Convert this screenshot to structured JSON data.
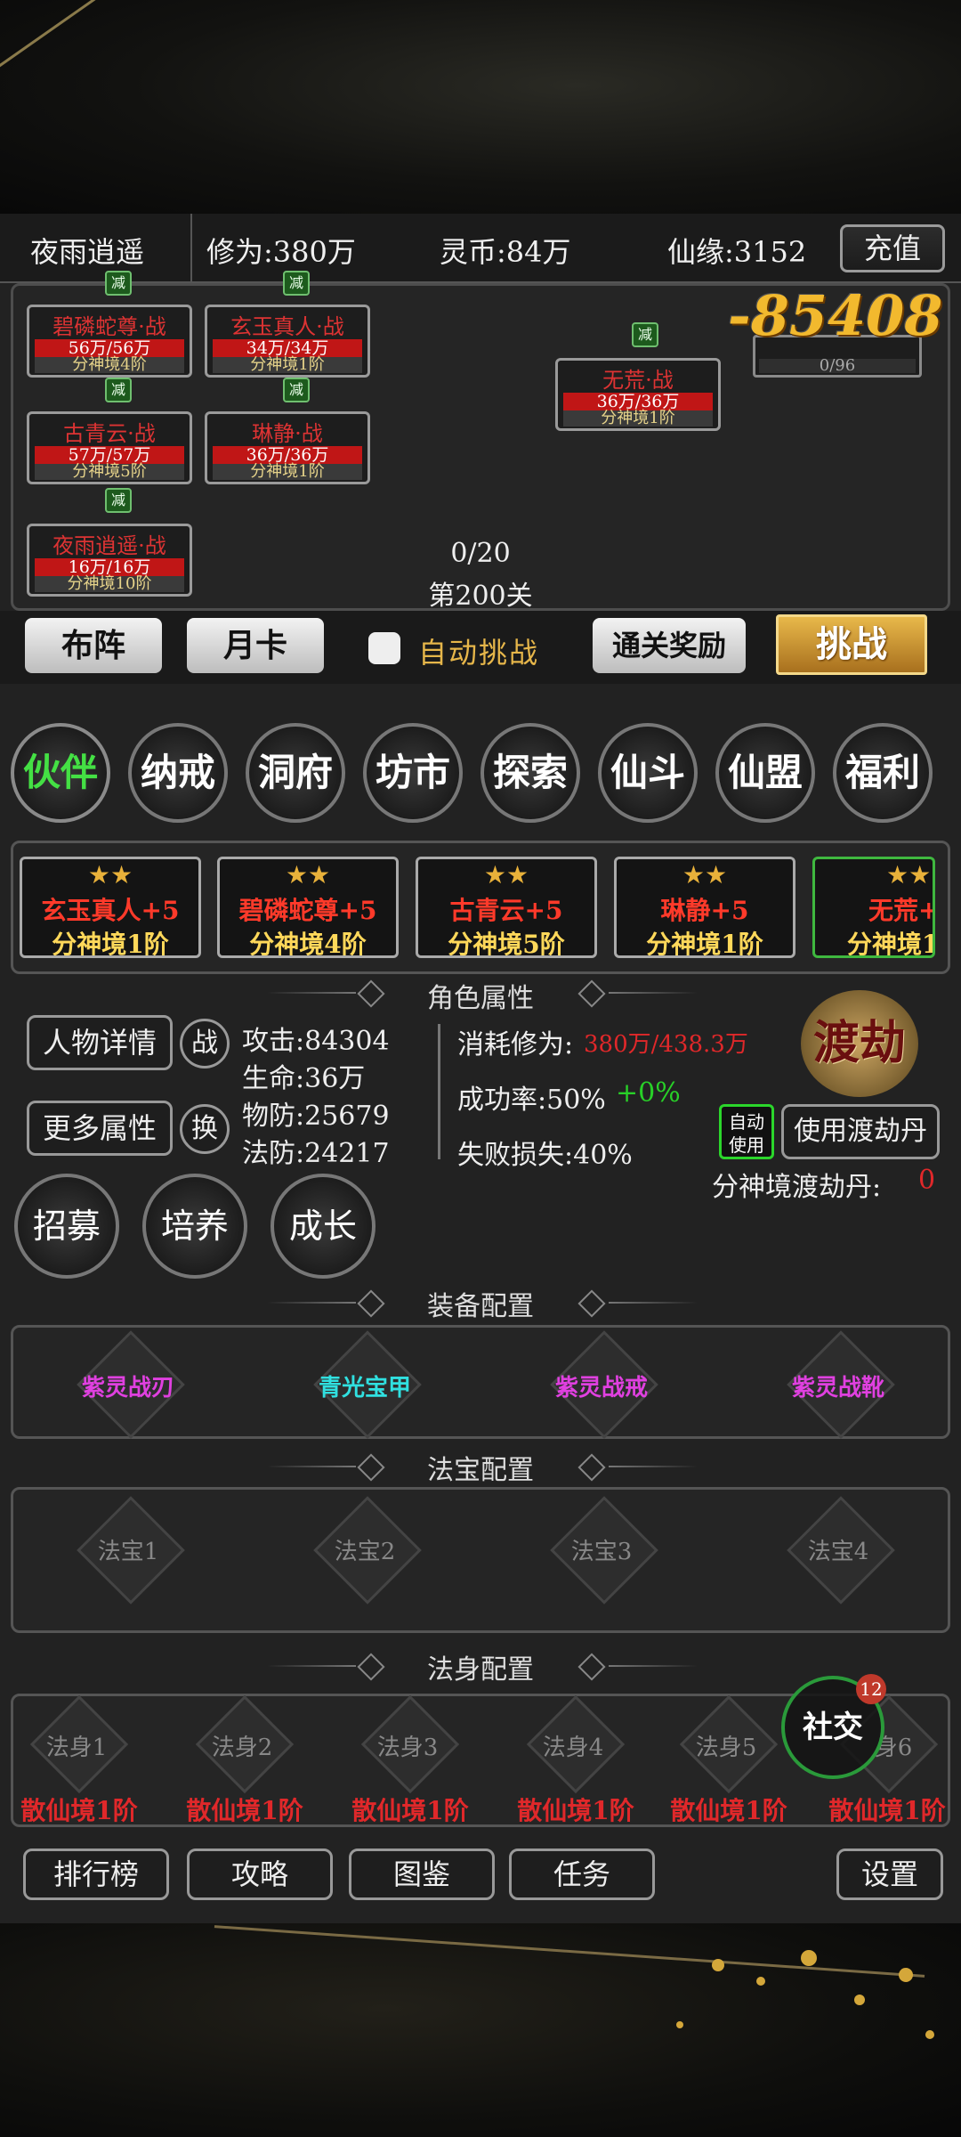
{
  "header": {
    "player_name": "夜雨逍遥",
    "cultivation": "修为:380万",
    "spirit_coins": "灵币:84万",
    "fate": "仙缘:3152",
    "recharge": "充值"
  },
  "battle": {
    "reduce_label": "减",
    "power": "-85408",
    "enemy_bar_text": "0/96",
    "allies": [
      {
        "name": "碧磷蛇尊·战",
        "hp": "56万/56万",
        "realm": "分神境4阶"
      },
      {
        "name": "玄玉真人·战",
        "hp": "34万/34万",
        "realm": "分神境1阶"
      },
      {
        "name": "古青云·战",
        "hp": "57万/57万",
        "realm": "分神境5阶"
      },
      {
        "name": "琳静·战",
        "hp": "36万/36万",
        "realm": "分神境1阶"
      },
      {
        "name": "夜雨逍遥·战",
        "hp": "16万/16万",
        "realm": "分神境10阶"
      }
    ],
    "enemy": {
      "name": "无荒·战",
      "hp": "36万/36万",
      "realm": "分神境1阶"
    },
    "progress": "0/20",
    "stage": "第200关"
  },
  "actions": {
    "formation": "布阵",
    "monthly_card": "月卡",
    "auto_challenge": "自动挑战",
    "clear_reward": "通关奖励",
    "challenge": "挑战"
  },
  "menu": [
    "伙伴",
    "纳戒",
    "洞府",
    "坊市",
    "探索",
    "仙斗",
    "仙盟",
    "福利"
  ],
  "partners": [
    {
      "stars": "★★",
      "name": "玄玉真人+5",
      "realm": "分神境1阶"
    },
    {
      "stars": "★★",
      "name": "碧磷蛇尊+5",
      "realm": "分神境4阶"
    },
    {
      "stars": "★★",
      "name": "古青云+5",
      "realm": "分神境5阶"
    },
    {
      "stars": "★★",
      "name": "琳静+5",
      "realm": "分神境1阶"
    },
    {
      "stars": "★★",
      "name": "无荒+",
      "realm": "分神境1"
    }
  ],
  "attributes": {
    "title": "角色属性",
    "detail_btn": "人物详情",
    "fight_btn": "战",
    "more_btn": "更多属性",
    "swap_btn": "换",
    "attack": "攻击:84304",
    "life": "生命:36万",
    "phys_def": "物防:25679",
    "magic_def": "法防:24217",
    "cost_label": "消耗修为:",
    "cost_value": "380万/438.3万",
    "success_label": "成功率:50%",
    "success_bonus": "+0%",
    "fail_loss": "失败损失:40%",
    "tribulation": "渡劫",
    "auto_use_1": "自动",
    "auto_use_2": "使用",
    "use_pill": "使用渡劫丹",
    "pill_label": "分神境渡劫丹:",
    "pill_count": "0"
  },
  "sub_actions": [
    "招募",
    "培养",
    "成长"
  ],
  "equipment": {
    "title": "装备配置",
    "items": [
      {
        "name": "紫灵战刃",
        "color": "#e040e0"
      },
      {
        "name": "青光宝甲",
        "color": "#30e0e0"
      },
      {
        "name": "紫灵战戒",
        "color": "#e040e0"
      },
      {
        "name": "紫灵战靴",
        "color": "#e040e0"
      }
    ]
  },
  "treasures": {
    "title": "法宝配置",
    "items": [
      "法宝1",
      "法宝2",
      "法宝3",
      "法宝4"
    ]
  },
  "bodies": {
    "title": "法身配置",
    "items": [
      {
        "name": "法身1",
        "realm": "散仙境1阶"
      },
      {
        "name": "法身2",
        "realm": "散仙境1阶"
      },
      {
        "name": "法身3",
        "realm": "散仙境1阶"
      },
      {
        "name": "法身4",
        "realm": "散仙境1阶"
      },
      {
        "name": "法身5",
        "realm": "散仙境1阶"
      },
      {
        "name": "身6",
        "realm": "散仙境1阶"
      }
    ]
  },
  "social": {
    "label": "社交",
    "badge": "12"
  },
  "bottom_nav": [
    "排行榜",
    "攻略",
    "图鉴",
    "任务",
    "设置"
  ]
}
